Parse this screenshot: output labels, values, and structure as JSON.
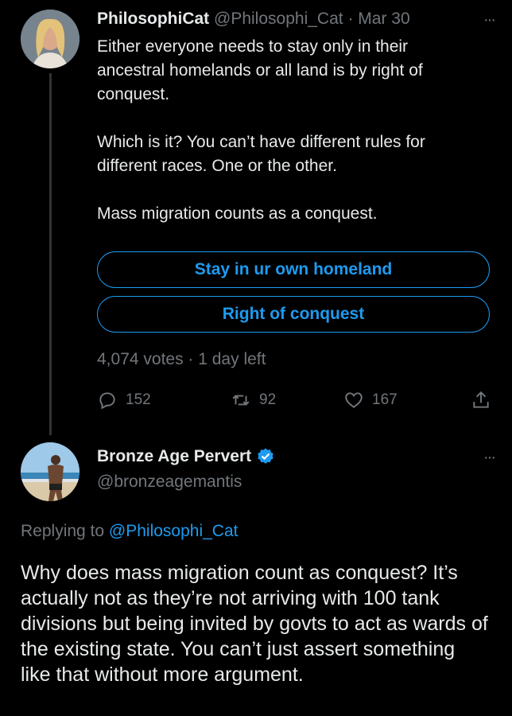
{
  "tweet1": {
    "name": "PhilosophiCat",
    "handle": "@Philosophi_Cat",
    "sep": "·",
    "date": "Mar 30",
    "more": "···",
    "text": "Either everyone needs to stay only in their\nancestral homelands or all land is by right of\nconquest.\n\nWhich is it? You can’t have different rules for\ndifferent races. One or the other.\n\nMass migration counts as a conquest.",
    "poll": {
      "options": [
        "Stay in ur own homeland",
        "Right of conquest"
      ],
      "meta": "4,074 votes · 1 day left"
    },
    "actions": {
      "replies": "152",
      "retweets": "92",
      "likes": "167"
    },
    "icons": [
      "reply-icon",
      "retweet-icon",
      "like-icon",
      "share-icon"
    ]
  },
  "tweet2": {
    "name": "Bronze Age Pervert",
    "handle": "@bronzeagemantis",
    "more": "···",
    "replying_prefix": "Replying to ",
    "replying_handle": "@Philosophi_Cat",
    "text": "Why does mass migration count as conquest? It’s actually not as they’re not arriving with 100 tank divisions but being invited by govts to act as wards of the existing state. You can’t just assert something like that without more argument."
  },
  "colors": {
    "background": "#000000",
    "text": "#e7e9ea",
    "muted": "#71767b",
    "accent": "#1d9bf0"
  }
}
